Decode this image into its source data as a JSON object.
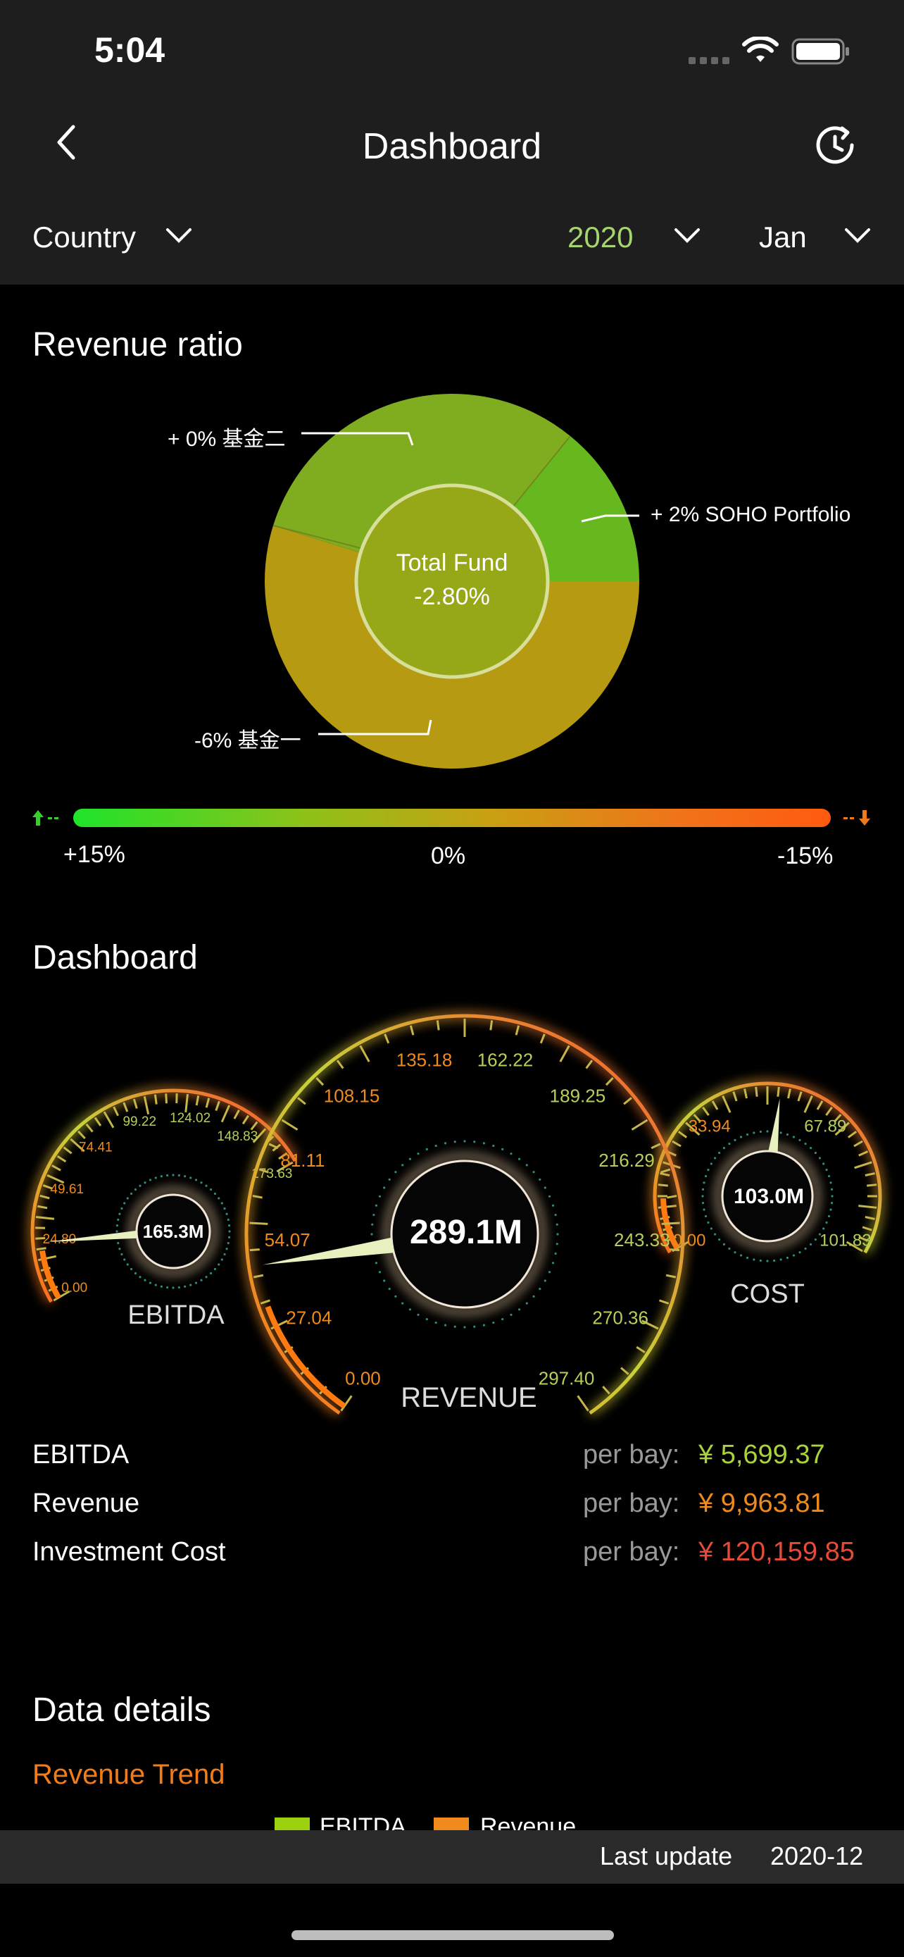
{
  "status_bar": {
    "time": "5:04"
  },
  "header": {
    "title": "Dashboard"
  },
  "filters": {
    "country": "Country",
    "year": "2020",
    "month": "Jan"
  },
  "revenue_ratio": {
    "title": "Revenue ratio",
    "center_label": "Total Fund",
    "center_value": "-2.80%",
    "slices": [
      {
        "label": "+ 0% 基金二",
        "color": "#80ad1f"
      },
      {
        "label": "+ 2% SOHO Portfolio",
        "color": "#67b81f"
      },
      {
        "label": "-6% 基金一",
        "color": "#b59a12"
      }
    ],
    "scale": {
      "left": "+15%",
      "mid": "0%",
      "right": "-15%"
    }
  },
  "dashboard": {
    "title": "Dashboard",
    "gauges": {
      "ebitda": {
        "value": "165.3M",
        "label": "EBITDA",
        "ticks": [
          "0.00",
          "24.80",
          "49.61",
          "74.41",
          "99.22",
          "124.02",
          "148.83",
          "173.63"
        ]
      },
      "revenue": {
        "value": "289.1M",
        "label": "REVENUE",
        "ticks": [
          "0.00",
          "27.04",
          "54.07",
          "81.11",
          "108.15",
          "135.18",
          "162.22",
          "189.25",
          "216.29",
          "243.33",
          "270.36",
          "297.40"
        ]
      },
      "cost": {
        "value": "103.0M",
        "label": "COST",
        "ticks": [
          "0.00",
          "33.94",
          "67.89",
          "101.83"
        ]
      }
    },
    "rows": [
      {
        "name": "EBITDA",
        "prefix": "per bay:",
        "amount": "¥ 5,699.37",
        "color": "#a8d33a"
      },
      {
        "name": "Revenue",
        "prefix": "per bay:",
        "amount": "¥ 9,963.81",
        "color": "#f08a1c"
      },
      {
        "name": "Investment Cost",
        "prefix": "per bay:",
        "amount": "¥ 120,159.85",
        "color": "#e84a3a"
      }
    ]
  },
  "data_details": {
    "title": "Data details",
    "subtitle": "Revenue Trend",
    "legend": [
      {
        "label": "EBITDA",
        "color": "#9bd10f"
      },
      {
        "label": "Revenue",
        "color": "#f08a1c"
      }
    ]
  },
  "footer": {
    "label": "Last update",
    "value": "2020-12"
  }
}
